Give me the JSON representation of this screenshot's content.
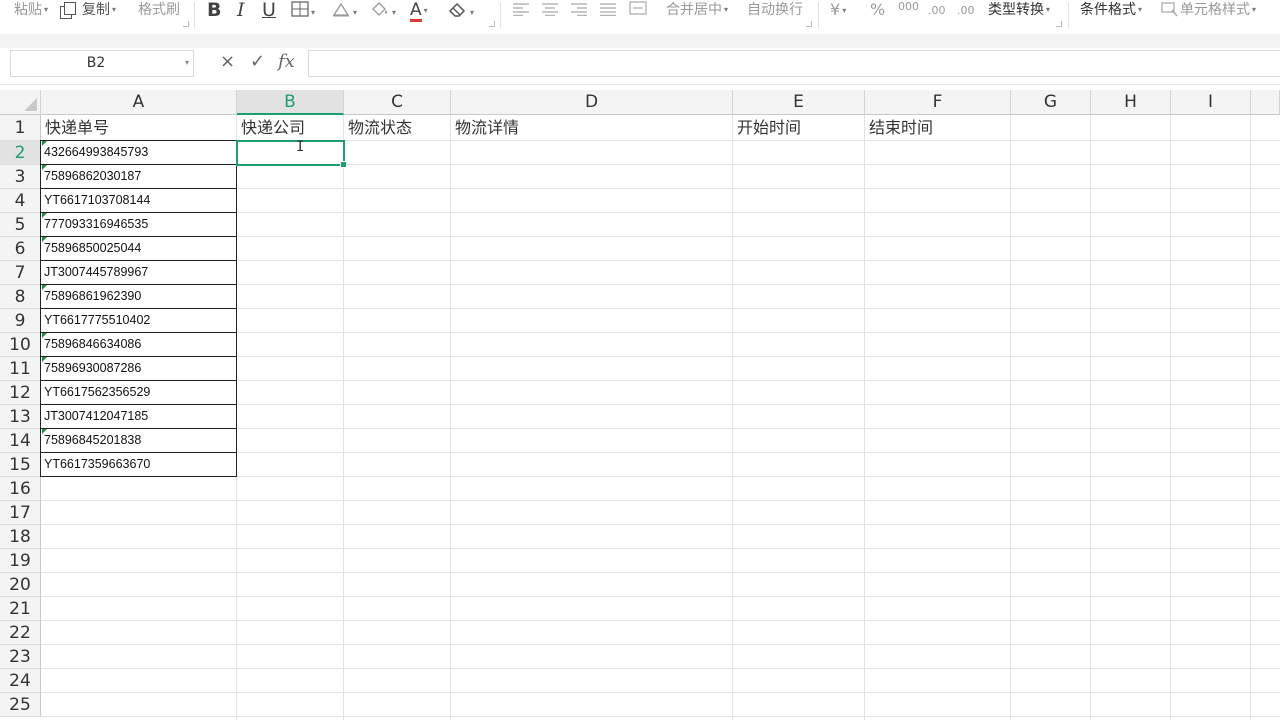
{
  "ribbon": {
    "paste": "粘贴",
    "copy": "复制",
    "format_painter": "格式刷",
    "bold": "B",
    "italic": "I",
    "underline": "U",
    "font_color_glyph": "A",
    "merge_center": "合并居中",
    "wrap_text": "自动换行",
    "currency_glyph": "¥",
    "percent_glyph": "%",
    "thousands_glyph": "000",
    "decimal_inc": ".00",
    "decimal_dec": ".00",
    "type_convert": "类型转换",
    "conditional_format": "条件格式",
    "cell_style": "单元格样式"
  },
  "formula_bar": {
    "name_box": "B2",
    "cancel_glyph": "×",
    "confirm_glyph": "✓",
    "fx_glyph": "fx",
    "value": ""
  },
  "sheet": {
    "columns": [
      "A",
      "B",
      "C",
      "D",
      "E",
      "F",
      "G",
      "H",
      "I"
    ],
    "selected_column": "B",
    "rows": [
      "1",
      "2",
      "3",
      "4",
      "5",
      "6",
      "7",
      "8",
      "9",
      "10",
      "11",
      "12",
      "13",
      "14",
      "15",
      "16",
      "17",
      "18",
      "19",
      "20",
      "21",
      "22",
      "23",
      "24",
      "25"
    ],
    "selected_row": "2",
    "selected_cell": "B2",
    "headers": {
      "A": "快递单号",
      "B": "快递公司",
      "C": "物流状态",
      "D": "物流详情",
      "E": "开始时间",
      "F": "结束时间"
    },
    "tracking_numbers": [
      "432664993845793",
      "75896862030187",
      "YT6617103708144",
      "777093316946535",
      "75896850025044",
      "JT3007445789967",
      "75896861962390",
      "YT6617775510402",
      "75896846634086",
      "75896930087286",
      "YT6617562356529",
      "JT3007412047185",
      "75896845201838",
      "YT6617359663670"
    ],
    "text_flagged_rows": [
      2,
      3,
      5,
      6,
      8,
      10,
      11,
      14
    ],
    "colors": {
      "selection": "#1aa06d",
      "text_flag": "#1e8c4c"
    }
  }
}
